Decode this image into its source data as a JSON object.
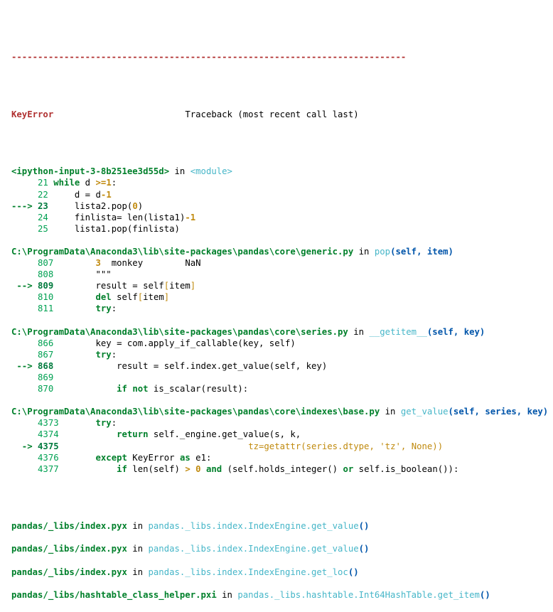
{
  "traceback": {
    "separator": "---------------------------------------------------------------------------",
    "exception_name": "KeyError",
    "header_note": "Traceback (most recent call last)",
    "frames": [
      {
        "location_label": "<ipython-input-3-8b251ee3d55d>",
        "in_keyword": "in",
        "function_name": "<module>",
        "function_args": "",
        "lines": [
          {
            "marker": "",
            "number": "21",
            "indent": " ",
            "code": "while d >=1:"
          },
          {
            "marker": "",
            "number": "22",
            "indent": "     ",
            "code": "d = d-1"
          },
          {
            "marker": "--->",
            "number": "23",
            "indent": "     ",
            "code": "lista2.pop(0)"
          },
          {
            "marker": "",
            "number": "24",
            "indent": "     ",
            "code": "finlista= len(lista1)-1"
          },
          {
            "marker": "",
            "number": "25",
            "indent": "     ",
            "code": "lista1.pop(finlista)"
          }
        ]
      },
      {
        "location_label": "C:\\ProgramData\\Anaconda3\\lib\\site-packages\\pandas\\core\\generic.py",
        "in_keyword": "in",
        "function_name": "pop",
        "function_args": "(self, item)",
        "lines": [
          {
            "marker": "",
            "number": "807",
            "indent": "        ",
            "code": "3  monkey        NaN"
          },
          {
            "marker": "",
            "number": "808",
            "indent": "        ",
            "code": "\"\"\""
          },
          {
            "marker": "-->",
            "number": "809",
            "indent": "        ",
            "code": "result = self[item]"
          },
          {
            "marker": "",
            "number": "810",
            "indent": "        ",
            "code": "del self[item]"
          },
          {
            "marker": "",
            "number": "811",
            "indent": "        ",
            "code": "try:"
          }
        ]
      },
      {
        "location_label": "C:\\ProgramData\\Anaconda3\\lib\\site-packages\\pandas\\core\\series.py",
        "in_keyword": "in",
        "function_name": "__getitem__",
        "function_args": "(self, key)",
        "lines": [
          {
            "marker": "",
            "number": "866",
            "indent": "        ",
            "code": "key = com.apply_if_callable(key, self)"
          },
          {
            "marker": "",
            "number": "867",
            "indent": "        ",
            "code": "try:"
          },
          {
            "marker": "-->",
            "number": "868",
            "indent": "            ",
            "code": "result = self.index.get_value(self, key)"
          },
          {
            "marker": "",
            "number": "869",
            "indent": "",
            "code": ""
          },
          {
            "marker": "",
            "number": "870",
            "indent": "            ",
            "code": "if not is_scalar(result):"
          }
        ]
      },
      {
        "location_label": "C:\\ProgramData\\Anaconda3\\lib\\site-packages\\pandas\\core\\indexes\\base.py",
        "in_keyword": "in",
        "function_name": "get_value",
        "function_args": "(self, series, key)",
        "lines": [
          {
            "marker": "",
            "number": "4373",
            "indent": "       ",
            "code": "try:"
          },
          {
            "marker": "",
            "number": "4374",
            "indent": "           ",
            "code": "return self._engine.get_value(s, k,"
          },
          {
            "marker": "->",
            "number": "4375",
            "indent": "                                    ",
            "code": "tz=getattr(series.dtype, 'tz', None))"
          },
          {
            "marker": "",
            "number": "4376",
            "indent": "       ",
            "code": "except KeyError as e1:"
          },
          {
            "marker": "",
            "number": "4377",
            "indent": "           ",
            "code": "if len(self) > 0 and (self.holds_integer() or self.is_boolean()):"
          }
        ]
      }
    ],
    "compiled_frames": [
      {
        "path": "pandas/_libs/index.pyx",
        "in_keyword": "in",
        "qualname": "pandas._libs.index.IndexEngine.get_value",
        "parens": "()"
      },
      {
        "path": "pandas/_libs/index.pyx",
        "in_keyword": "in",
        "qualname": "pandas._libs.index.IndexEngine.get_value",
        "parens": "()"
      },
      {
        "path": "pandas/_libs/index.pyx",
        "in_keyword": "in",
        "qualname": "pandas._libs.index.IndexEngine.get_loc",
        "parens": "()"
      },
      {
        "path": "pandas/_libs/hashtable_class_helper.pxi",
        "in_keyword": "in",
        "qualname": "pandas._libs.hashtable.Int64HashTable.get_item",
        "parens": "()"
      }
    ]
  },
  "colors": {
    "error_red": "#b03030",
    "path_green": "#00802b",
    "lineno_green": "#00a152",
    "function_cyan": "#46b6c8",
    "args_blue": "#0055aa",
    "literal_gold": "#c08a0e",
    "background": "#ffffff",
    "text": "#000000"
  }
}
